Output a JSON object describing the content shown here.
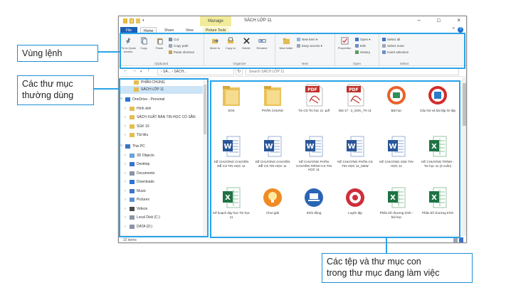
{
  "window": {
    "title": "SÁCH LỚP 11",
    "manage_tab": "Manage",
    "minimize": "–",
    "maximize": "☐",
    "close": "×"
  },
  "tabs": [
    {
      "label": "File"
    },
    {
      "label": "Home"
    },
    {
      "label": "Share"
    },
    {
      "label": "View"
    },
    {
      "label": "Picture Tools"
    }
  ],
  "ribbon": {
    "clipboard": {
      "group": "Clipboard",
      "pin": "Pin to Quick access",
      "copy": "Copy",
      "paste": "Paste",
      "cut": "Cut",
      "copy_path": "Copy path",
      "paste_shortcut": "Paste shortcut"
    },
    "organize": {
      "group": "Organize",
      "move_to": "Move to",
      "copy_to": "Copy to",
      "delete": "Delete",
      "rename": "Rename"
    },
    "new": {
      "group": "New",
      "new_folder": "New folder",
      "new_item": "New item ▾",
      "easy_access": "Easy access ▾"
    },
    "open": {
      "group": "Open",
      "properties": "Properties",
      "open": "Open ▾",
      "edit": "Edit",
      "history": "History"
    },
    "select": {
      "group": "Select",
      "select_all": "Select all",
      "select_none": "Select none",
      "invert": "Invert selection"
    }
  },
  "address": {
    "path": "› SÁ... › SÁCH...",
    "search_placeholder": "Search SÁCH LỚP 11",
    "back": "←",
    "forward": "→",
    "up": "↑",
    "refresh": "↻"
  },
  "nav": {
    "items": [
      {
        "label": "PHẦN CHUNG",
        "icon": "folder-icon"
      },
      {
        "label": "SÁCH LỚP 11",
        "icon": "folder-icon"
      },
      {
        "label": "OneDrive - Personal",
        "icon": "cloud-icon"
      },
      {
        "label": "Hình ảnh",
        "icon": "folder-icon"
      },
      {
        "label": "SÁCH XUẤT BẢN TIN HỌC CÓ SẴN",
        "icon": "folder-icon"
      },
      {
        "label": "SGK 10",
        "icon": "folder-icon"
      },
      {
        "label": "Tài liệu",
        "icon": "folder-icon"
      },
      {
        "label": "This PC",
        "icon": "pc-icon"
      },
      {
        "label": "3D Objects",
        "icon": "cube-icon"
      },
      {
        "label": "Desktop",
        "icon": "desktop-icon"
      },
      {
        "label": "Documents",
        "icon": "documents-icon"
      },
      {
        "label": "Downloads",
        "icon": "download-icon"
      },
      {
        "label": "Music",
        "icon": "music-icon"
      },
      {
        "label": "Pictures",
        "icon": "pictures-icon"
      },
      {
        "label": "Videos",
        "icon": "videos-icon"
      },
      {
        "label": "Local Disk (C:)",
        "icon": "disk-icon"
      },
      {
        "label": "DATA (D:)",
        "icon": "disk-icon"
      }
    ]
  },
  "files": [
    {
      "label": "SGK",
      "type": "folder"
    },
    {
      "label": "PHẦN CHUNG",
      "type": "folder"
    },
    {
      "label": "Tin CS Tin học 11 .pdf",
      "type": "pdf"
    },
    {
      "label": "Bài 17 - 2_SGK_TH 11",
      "type": "pdf"
    },
    {
      "label": "Bài học",
      "type": "app-orange"
    },
    {
      "label": "Câu hỏi và bài tập ôn tập",
      "type": "app-red"
    },
    {
      "label": "KẾ CHƯƠNG CHUYÊN ĐỀ CS TIN HỌC 11",
      "type": "word"
    },
    {
      "label": "KẾ CHƯƠNG CHUYÊN ĐỀ CS TIN HỌC 11",
      "type": "word"
    },
    {
      "label": "KẾ CHƯƠNG PHẦN CHUYÊN TRÌNH CS TIN HỌC 11",
      "type": "word"
    },
    {
      "label": "KẾ CHƯƠNG PHẦN CS TIN HỌC 11_NEW",
      "type": "word"
    },
    {
      "label": "KẾ CHƯƠNG SGK TIN HỌC 11",
      "type": "word"
    },
    {
      "label": "KẾ CHƯƠNG TRÌNH - Tin học 11 (3 cuốn)",
      "type": "excel"
    },
    {
      "label": "Kế hoạch dạy học Tin học 11",
      "type": "excel"
    },
    {
      "label": "Chơi giải",
      "type": "app-bulb"
    },
    {
      "label": "Khởi động",
      "type": "app-laptop"
    },
    {
      "label": "Luyện tập",
      "type": "app-target"
    },
    {
      "label": "Phân bố chương trình - bài học",
      "type": "excel"
    },
    {
      "label": "Phân bố chương trình",
      "type": "excel"
    }
  ],
  "status": {
    "items_count": "22 items"
  },
  "callouts": {
    "ribbon": "Vùng lệnh",
    "nav": "Các thư mục thường dùng",
    "files_line1": "Các tệp và thư mục con",
    "files_line2": "trong thư mục đang làm việc"
  },
  "colors": {
    "accent": "#29a3e8",
    "file_tab": "#1a5fb4",
    "selection": "#cce4f7",
    "manage_tab": "#f2ec9a"
  }
}
